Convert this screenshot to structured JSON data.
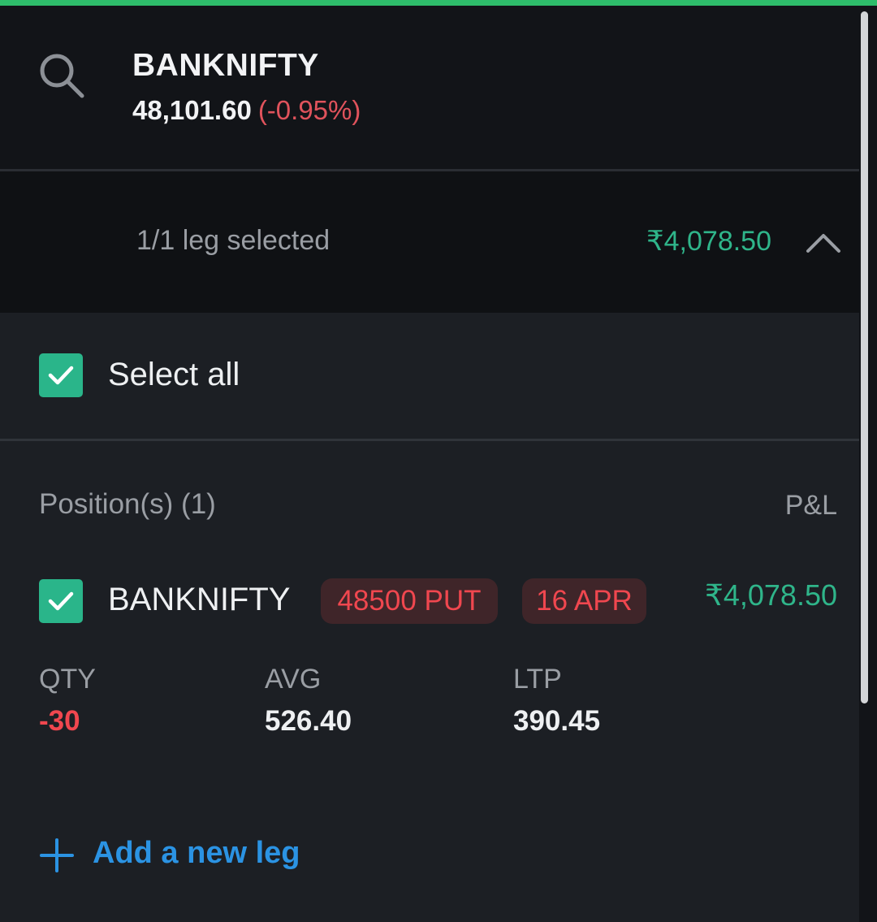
{
  "header": {
    "symbol": "BANKNIFTY",
    "price": "48,101.60",
    "change": "(-0.95%)"
  },
  "leg_bar": {
    "selected_text": "1/1 leg selected",
    "pnl": "₹4,078.50"
  },
  "select_all": {
    "label": "Select all",
    "checked": true
  },
  "positions": {
    "header": "Position(s) (1)",
    "pnl_header": "P&L",
    "items": [
      {
        "checked": true,
        "symbol": "BANKNIFTY",
        "strike": "48500 PUT",
        "expiry": "16 APR",
        "pnl": "₹4,078.50",
        "qty_label": "QTY",
        "qty": "-30",
        "avg_label": "AVG",
        "avg": "526.40",
        "ltp_label": "LTP",
        "ltp": "390.45"
      }
    ]
  },
  "add_leg": {
    "label": "Add a new leg"
  },
  "colors": {
    "accent": "#2ebd6b",
    "profit": "#2fb58a",
    "loss": "#f0474f",
    "link": "#2b93e3",
    "checkbox": "#2ab58a"
  },
  "icons": [
    "search-icon",
    "chevron-up-icon",
    "checkmark-icon",
    "plus-icon"
  ]
}
